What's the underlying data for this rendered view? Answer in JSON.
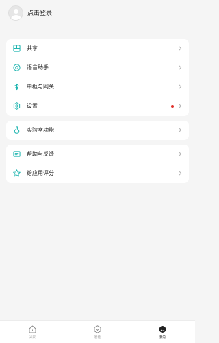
{
  "header": {
    "login_label": "点击登录"
  },
  "menu_group_1": [
    {
      "label": "共享",
      "icon": "share-grid-icon"
    },
    {
      "label": "语音助手",
      "icon": "voice-assistant-icon"
    },
    {
      "label": "中枢与网关",
      "icon": "bluetooth-icon"
    },
    {
      "label": "设置",
      "icon": "settings-gear-icon",
      "notification_dot": true
    }
  ],
  "menu_group_2": [
    {
      "label": "实验室功能",
      "icon": "flask-icon"
    }
  ],
  "menu_group_3": [
    {
      "label": "帮助与反馈",
      "icon": "feedback-icon"
    },
    {
      "label": "给应用评分",
      "icon": "star-icon"
    }
  ],
  "tabbar": {
    "items": [
      {
        "label": "米家",
        "icon": "home-icon",
        "active": false
      },
      {
        "label": "智能",
        "icon": "smart-hexagon-icon",
        "active": false
      },
      {
        "label": "我的",
        "icon": "profile-icon",
        "active": true
      }
    ]
  },
  "colors": {
    "accent": "#1fb5b0",
    "notification": "#e0312b",
    "background": "#f5f5f5"
  }
}
